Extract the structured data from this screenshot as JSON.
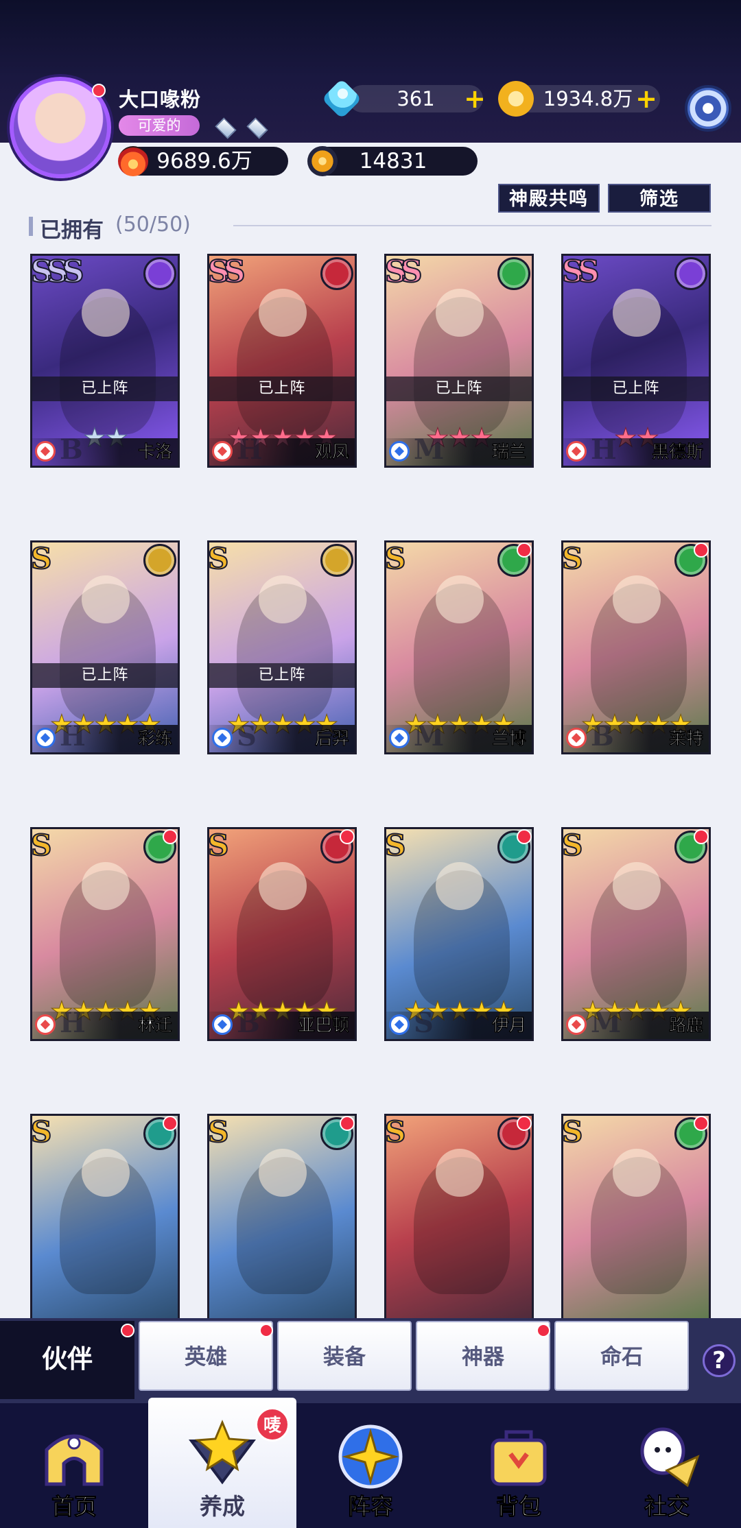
{
  "player": {
    "name": "大口喙粉",
    "title": "可爱的",
    "diamonds": "361",
    "gold": "1934.8万",
    "power": "9689.6万",
    "exp": "14831"
  },
  "actions": {
    "resonance": "神殿共鸣",
    "filter": "筛选"
  },
  "owned": {
    "label": "已拥有",
    "count": "(50/50)"
  },
  "deployed_label": "已上阵",
  "cards": [
    {
      "name": "卡洛",
      "grade": "SSS",
      "stars": "★★",
      "star_style": "silver",
      "deployed": true,
      "faction": "dark",
      "reddot": false,
      "letter": "B",
      "class": "red"
    },
    {
      "name": "观凤",
      "grade": "SS",
      "stars": "★★★★★",
      "star_style": "pink",
      "deployed": true,
      "faction": "fire",
      "reddot": false,
      "letter": "H",
      "class": "red"
    },
    {
      "name": "瑞兰",
      "grade": "SS",
      "stars": "★★★",
      "star_style": "pink",
      "deployed": true,
      "faction": "nature",
      "reddot": false,
      "letter": "M",
      "class": "blue"
    },
    {
      "name": "黑德斯",
      "grade": "SS",
      "stars": "★★",
      "star_style": "pink",
      "deployed": true,
      "faction": "dark",
      "reddot": false,
      "letter": "H",
      "class": "red"
    },
    {
      "name": "彩练",
      "grade": "S",
      "stars": "★★★★★",
      "star_style": "gold",
      "deployed": true,
      "faction": "light",
      "reddot": false,
      "letter": "H",
      "class": "blue"
    },
    {
      "name": "后羿",
      "grade": "S",
      "stars": "★★★★★",
      "star_style": "gold",
      "deployed": true,
      "faction": "light",
      "reddot": false,
      "letter": "S",
      "class": "blue"
    },
    {
      "name": "兰博",
      "grade": "S",
      "stars": "★★★★★",
      "star_style": "gold",
      "deployed": false,
      "faction": "nature",
      "reddot": true,
      "letter": "M",
      "class": "blue"
    },
    {
      "name": "莱特",
      "grade": "S",
      "stars": "★★★★★",
      "star_style": "gold",
      "deployed": false,
      "faction": "nature",
      "reddot": true,
      "letter": "B",
      "class": "red"
    },
    {
      "name": "林迁",
      "grade": "S",
      "stars": "★★★★★",
      "star_style": "gold",
      "deployed": false,
      "faction": "nature",
      "reddot": true,
      "letter": "H",
      "class": "red"
    },
    {
      "name": "亚巴顿",
      "grade": "S",
      "stars": "★★★★★",
      "star_style": "gold",
      "deployed": false,
      "faction": "fire",
      "reddot": true,
      "letter": "B",
      "class": "blue"
    },
    {
      "name": "伊月",
      "grade": "S",
      "stars": "★★★★★",
      "star_style": "gold",
      "deployed": false,
      "faction": "water",
      "reddot": true,
      "letter": "S",
      "class": "blue"
    },
    {
      "name": "路鹿",
      "grade": "S",
      "stars": "★★★★★",
      "star_style": "gold",
      "deployed": false,
      "faction": "nature",
      "reddot": true,
      "letter": "M",
      "class": "red"
    },
    {
      "name": "",
      "grade": "S",
      "stars": "",
      "star_style": "gold",
      "deployed": false,
      "faction": "water",
      "reddot": true,
      "letter": "",
      "class": "red"
    },
    {
      "name": "",
      "grade": "S",
      "stars": "",
      "star_style": "gold",
      "deployed": false,
      "faction": "water",
      "reddot": true,
      "letter": "",
      "class": "red"
    },
    {
      "name": "",
      "grade": "S",
      "stars": "",
      "star_style": "gold",
      "deployed": false,
      "faction": "fire",
      "reddot": true,
      "letter": "",
      "class": "red"
    },
    {
      "name": "",
      "grade": "S",
      "stars": "",
      "star_style": "gold",
      "deployed": false,
      "faction": "nature",
      "reddot": true,
      "letter": "",
      "class": "red"
    }
  ],
  "colors": {
    "faction_dark": "#7a3fd6",
    "faction_fire": "#c6283a",
    "faction_nature": "#2fa84a",
    "faction_light": "#d4a52a",
    "faction_water": "#1f9c8c"
  },
  "tabs": [
    {
      "label": "伙伴",
      "active": true,
      "dot": true
    },
    {
      "label": "英雄",
      "active": false,
      "dot": true
    },
    {
      "label": "装备",
      "active": false,
      "dot": false
    },
    {
      "label": "神器",
      "active": false,
      "dot": true
    },
    {
      "label": "命石",
      "active": false,
      "dot": false
    }
  ],
  "help_icon": "?",
  "nav": [
    {
      "label": "首页",
      "icon": "home-icon",
      "active": false
    },
    {
      "label": "养成",
      "icon": "upgrade-icon",
      "active": true,
      "badge": "唛"
    },
    {
      "label": "阵容",
      "icon": "lineup-icon",
      "active": false
    },
    {
      "label": "背包",
      "icon": "backpack-icon",
      "active": false
    },
    {
      "label": "社交",
      "icon": "social-icon",
      "active": false
    }
  ]
}
